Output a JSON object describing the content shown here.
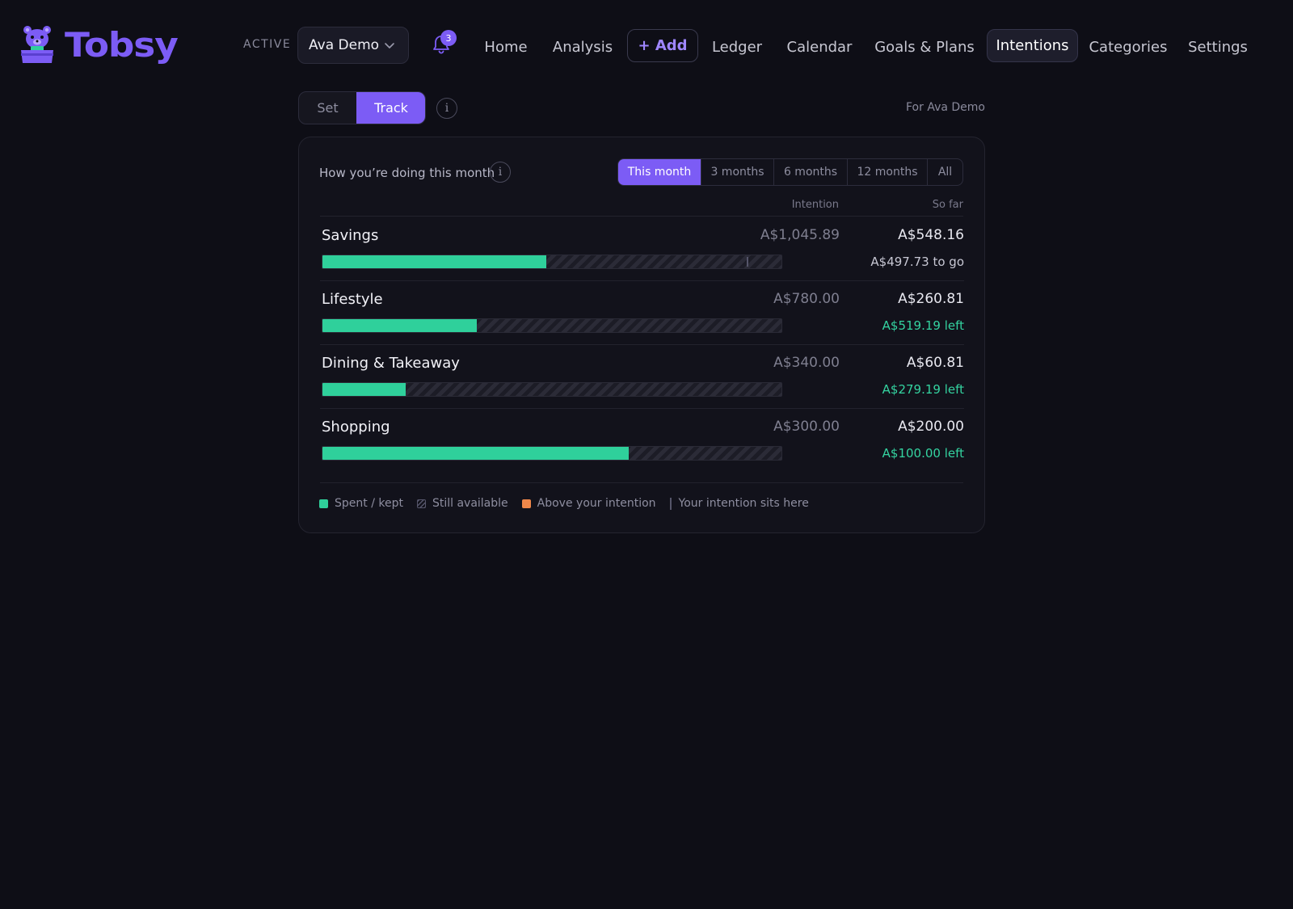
{
  "app": {
    "brand": "Tobsy",
    "active_label": "ACTIVE",
    "profile": "Ava Demo",
    "notifications": "3"
  },
  "nav": {
    "home": "Home",
    "analysis": "Analysis",
    "add": "+ Add",
    "ledger": "Ledger",
    "calendar": "Calendar",
    "goals": "Goals & Plans",
    "intentions": "Intentions",
    "categories": "Categories",
    "settings": "Settings",
    "active": "Intentions"
  },
  "toolbar": {
    "set": "Set",
    "track": "Track",
    "selected_mode": "Track",
    "info": "i",
    "for_label": "For Ava Demo"
  },
  "card": {
    "title": "How you’re doing this month",
    "info": "i",
    "ranges": [
      "This month",
      "3 months",
      "6 months",
      "12 months",
      "All"
    ],
    "selected_range": "This month",
    "col_intention": "Intention",
    "col_so_far": "So far"
  },
  "rows": [
    {
      "name": "Savings",
      "intention": "A$1,045.89",
      "so_far": "A$548.16",
      "note": "A$497.73 to go",
      "note_kind": "togo",
      "progress": 0.487,
      "marker": 0.925
    },
    {
      "name": "Lifestyle",
      "intention": "A$780.00",
      "so_far": "A$260.81",
      "note": "A$519.19 left",
      "note_kind": "left",
      "progress": 0.336,
      "marker": null
    },
    {
      "name": "Dining & Takeaway",
      "intention": "A$340.00",
      "so_far": "A$60.81",
      "note": "A$279.19 left",
      "note_kind": "left",
      "progress": 0.181,
      "marker": null
    },
    {
      "name": "Shopping",
      "intention": "A$300.00",
      "so_far": "A$200.00",
      "note": "A$100.00 left",
      "note_kind": "left",
      "progress": 0.667,
      "marker": null
    }
  ],
  "legend": {
    "spent": "Spent / kept",
    "available": "Still available",
    "above": "Above your intention",
    "marker": "Your intention sits here"
  },
  "colors": {
    "accent": "#7c5cf5",
    "progress": "#2fd09b",
    "above": "#f0884a",
    "left_text": "#34d3a0"
  }
}
